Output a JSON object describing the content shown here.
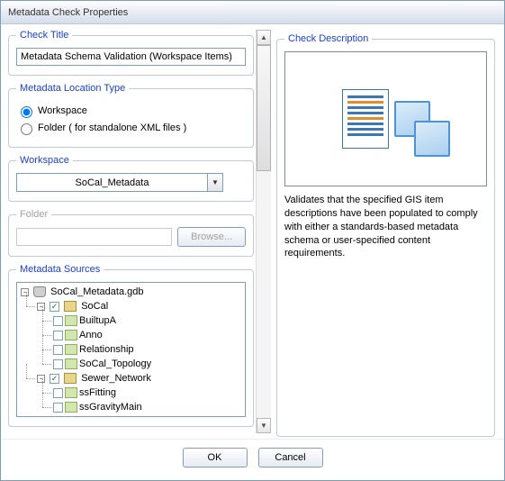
{
  "window_title": "Metadata Check Properties",
  "sections": {
    "check_title": {
      "legend": "Check Title",
      "value": "Metadata Schema Validation (Workspace Items)"
    },
    "location_type": {
      "legend": "Metadata Location Type",
      "options": {
        "workspace": "Workspace",
        "folder": "Folder ( for standalone XML files )"
      },
      "selected": "workspace"
    },
    "workspace": {
      "legend": "Workspace",
      "value": "SoCal_Metadata"
    },
    "folder": {
      "legend": "Folder",
      "value": "",
      "browse": "Browse..."
    },
    "sources": {
      "legend": "Metadata Sources"
    },
    "description": {
      "legend": "Check Description",
      "text": "Validates that the specified GIS item descriptions have been populated to comply with either a standards-based metadata schema or user-specified content requirements."
    }
  },
  "tree": {
    "root": "SoCal_Metadata.gdb",
    "ds1": "SoCal",
    "ds1_items": {
      "a": "BuiltupA",
      "b": "Anno",
      "c": "Relationship",
      "d": "SoCal_Topology"
    },
    "ds2": "Sewer_Network",
    "ds2_items": {
      "a": "ssFitting",
      "b": "ssGravityMain"
    }
  },
  "buttons": {
    "ok": "OK",
    "cancel": "Cancel"
  }
}
